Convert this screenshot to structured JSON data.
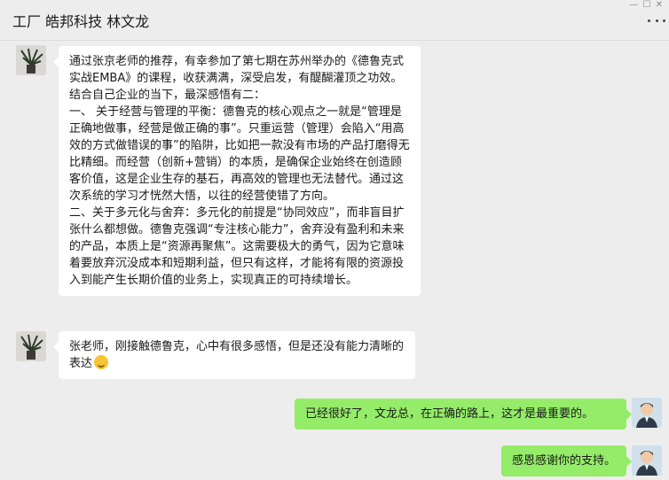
{
  "header": {
    "title": "工厂 皓邦科技 林文龙",
    "top_controls": "— ☐ ✕"
  },
  "messages": [
    {
      "side": "left",
      "paragraphs": [
        "通过张京老师的推荐，有幸参加了第七期在苏州举办的《德鲁克式实战EMBA》的课程，收获满满，深受启发，有醍醐灌顶之功效。结合自己企业的当下，最深感悟有二：",
        "一、 关于经营与管理的平衡：德鲁克的核心观点之一就是“管理是正确地做事，经营是做正确的事”。只重运营（管理）会陷入“用高效的方式做错误的事”的陷阱，比如把一款没有市场的产品打磨得无比精细。而经营（创新+营销）的本质，是确保企业始终在创造顾客价值，这是企业生存的基石，再高效的管理也无法替代。通过这次系统的学习才恍然大悟，以往的经营使错了方向。",
        "二、关于多元化与舍弃：多元化的前提是“协同效应”，而非盲目扩张什么都想做。德鲁克强调“专注核心能力”，舍弃没有盈利和未来的产品，本质上是“资源再聚焦”。这需要极大的勇气，因为它意味着要放弃沉没成本和短期利益，但只有这样，才能将有限的资源投入到能产生长期价值的业务上，实现真正的可持续增长。"
      ]
    },
    {
      "side": "left",
      "text": "张老师，刚接触德鲁克，心中有很多感悟，但是还没有能力清晰的表达",
      "emoji": "grimace-emoji"
    },
    {
      "side": "right",
      "text": "已经很好了，文龙总，在正确的路上，这才是最重要的。"
    },
    {
      "side": "right",
      "text": "感恩感谢你的支持。"
    }
  ],
  "colors": {
    "background": "#ededed",
    "incoming_bubble": "#ffffff",
    "outgoing_bubble": "#95ec69"
  }
}
